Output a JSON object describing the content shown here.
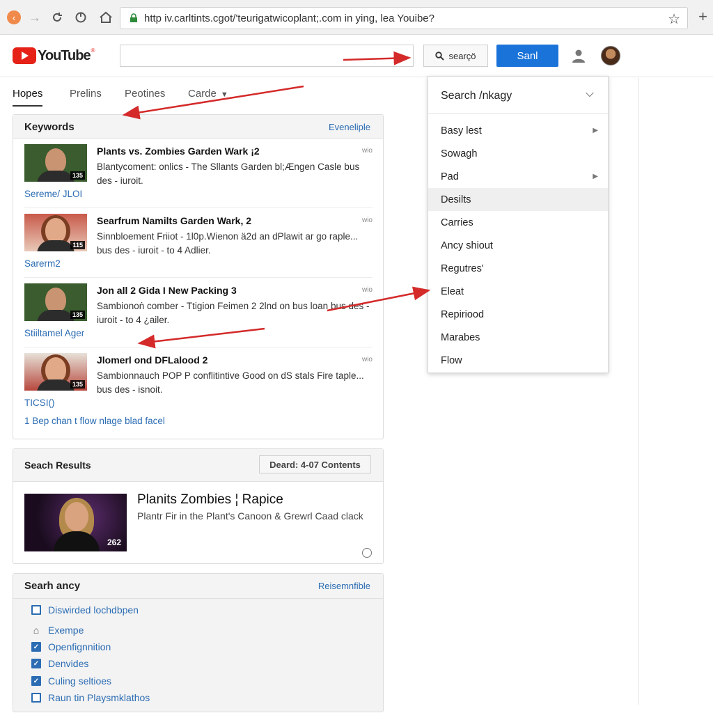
{
  "browser": {
    "url": "http iv.carltints.cgot/'teurigatwicoplant;.com in ying, lea  Youibe?"
  },
  "header": {
    "logo_text": "YouTube",
    "logo_sup": "®",
    "search_value": "",
    "search_button": "searçö",
    "primary_button": "Sanl",
    "accent_color": "#1a73d9",
    "brand_color": "#e62117"
  },
  "tabs": [
    {
      "label": "Hopes",
      "active": true
    },
    {
      "label": "Prelins"
    },
    {
      "label": "Peotines"
    },
    {
      "label": "Carde",
      "has_caret": true
    }
  ],
  "keywords_panel": {
    "title": "Keywords",
    "link": "Eveneliple",
    "videos": [
      {
        "title": "Plants vs. Zombies Garden Wark ¡2",
        "desc": "Blantycoment: onlics - The Sllants Garden bl;Ængen Casle bus des - iuroit.",
        "channel": "Sereme/ JLOI",
        "duration": "135",
        "meta": "wio"
      },
      {
        "title": "Searfrum Namilts Garden Wark, 2",
        "desc": "Sinnbloement Friiot - 1l0p.Wienon ä2d an dPlawit ar go raple... bus des - iuroit - to 4 Adlier.",
        "channel": "Sarerm2",
        "duration": "115",
        "meta": "wio"
      },
      {
        "title": "Jon all 2 Gida I New Packing 3",
        "desc": "Sambionoṅ comber - Ttigion Feimen 2 2lnd on bus loan bus des - iuroit - to 4 ¿ailer.",
        "channel": "Stiiltamel Ager",
        "duration": "135",
        "meta": "wio"
      },
      {
        "title": "Jlomerl ond DFLalood 2",
        "desc": "Sambionnauch POP P conflitintive Good on dS stals Fire taple... bus des - isnoit.",
        "channel": "TICSI()",
        "duration": "135",
        "meta": "wio"
      }
    ],
    "footer_link": "1 Bep chan t flow nlage blad facel"
  },
  "search_results": {
    "title": "Seach Results",
    "count_button": "Deard: 4-07 Contents",
    "result": {
      "title": "Planits Zombies ¦ Rapice",
      "desc": "Plantr Fir in the Plant's Canoon & Grewrl Caad clack",
      "duration": "262"
    }
  },
  "search_agency": {
    "title": "Searh ancy",
    "link": "Reisemnfible",
    "options": [
      {
        "label": "Diswirded lochdbpen",
        "icon": "checkbox-empty"
      },
      {
        "label": "Exempe",
        "icon": "home-icon"
      },
      {
        "label": "Openfignnition",
        "icon": "checkbox-checked"
      },
      {
        "label": "Denvides",
        "icon": "checkbox-checked"
      },
      {
        "label": "Culing seltioes",
        "icon": "checkbox-checked"
      },
      {
        "label": "Raun tin Playsmklathos",
        "icon": "checkbox-empty"
      }
    ]
  },
  "dropdown": {
    "title": "Search /nkagy",
    "items": [
      {
        "label": "Basy lest",
        "submenu": true
      },
      {
        "label": "Sowagh"
      },
      {
        "label": "Pad",
        "submenu": true
      },
      {
        "label": "Desilts",
        "highlighted": true
      },
      {
        "label": "Carries"
      },
      {
        "label": "Ancy shiout"
      },
      {
        "label": "Regutres'"
      },
      {
        "label": "Eleat"
      },
      {
        "label": "Repiriood"
      },
      {
        "label": "Marabes"
      },
      {
        "label": "Flow"
      }
    ]
  },
  "annotation_color": "#d42a2a"
}
